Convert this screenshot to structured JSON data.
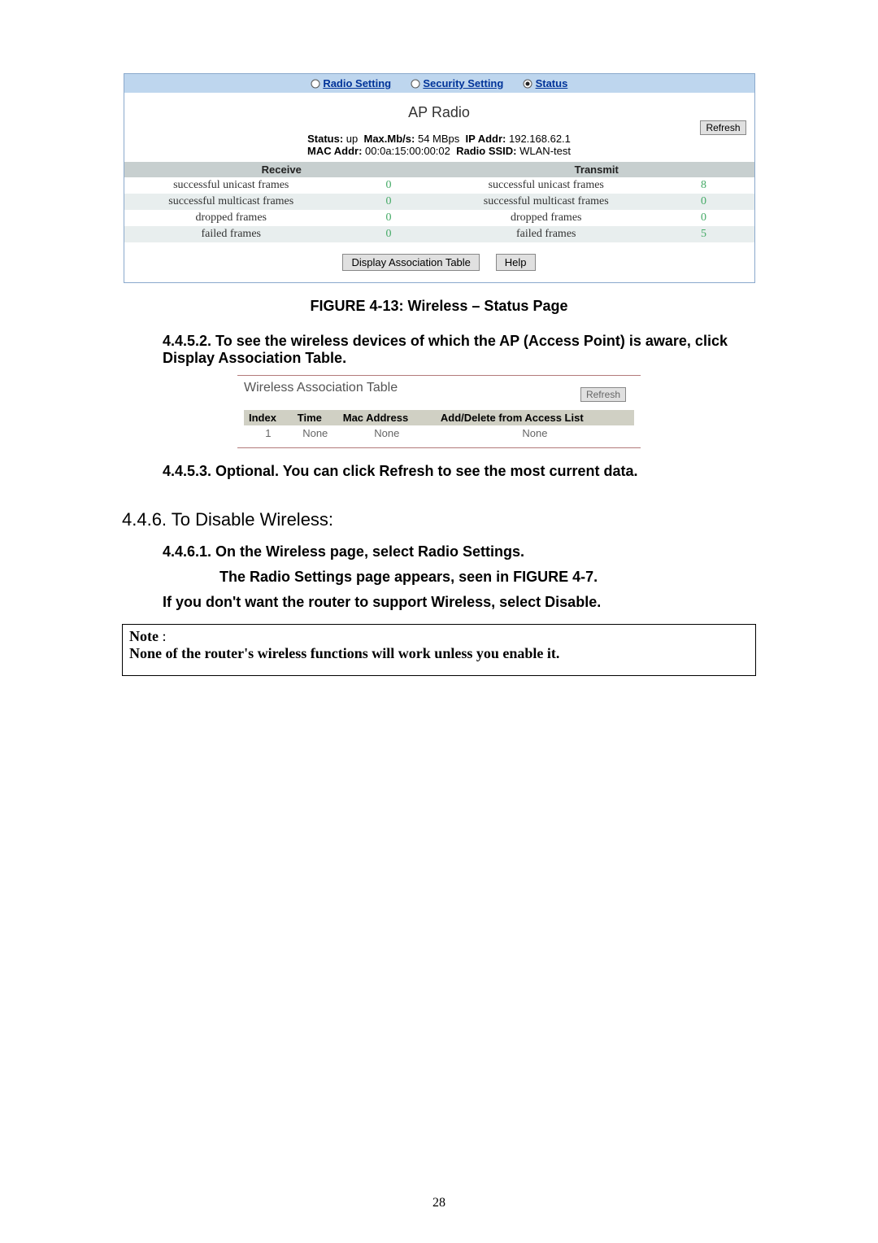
{
  "tabs": {
    "radio": "Radio Setting",
    "security": "Security Setting",
    "status": "Status"
  },
  "ap": {
    "title": "AP Radio",
    "refresh": "Refresh",
    "status_label": "Status:",
    "status_val": "up",
    "maxmb_label": "Max.Mb/s:",
    "maxmb_val": "54 MBps",
    "ipaddr_label": "IP Addr:",
    "ipaddr_val": "192.168.62.1",
    "macaddr_label": "MAC Addr:",
    "macaddr_val": "00:0a:15:00:00:02",
    "ssid_label": "Radio SSID:",
    "ssid_val": "WLAN-test",
    "col_receive": "Receive",
    "col_transmit": "Transmit",
    "rows": [
      {
        "rlabel": "successful unicast frames",
        "rval": "0",
        "tlabel": "successful unicast frames",
        "tval": "8"
      },
      {
        "rlabel": "successful multicast frames",
        "rval": "0",
        "tlabel": "successful multicast frames",
        "tval": "0"
      },
      {
        "rlabel": "dropped frames",
        "rval": "0",
        "tlabel": "dropped frames",
        "tval": "0"
      },
      {
        "rlabel": "failed frames",
        "rval": "0",
        "tlabel": "failed frames",
        "tval": "5"
      }
    ],
    "btn_display": "Display Association Table",
    "btn_help": "Help"
  },
  "figcap": "FIGURE 4-13: Wireless – Status Page",
  "p_4_4_5_2": "4.4.5.2. To see the wireless devices of which the AP (Access Point) is aware, click Display Association Table.",
  "assoc": {
    "title": "Wireless Association Table",
    "refresh": "Refresh",
    "h_index": "Index",
    "h_time": "Time",
    "h_mac": "Mac Address",
    "h_access": "Add/Delete from Access List",
    "r_index": "1",
    "r_time": "None",
    "r_mac": "None",
    "r_access": "None"
  },
  "p_4_4_5_3": "4.4.5.3. Optional. You can click Refresh to see the most current data.",
  "h_4_4_6": "4.4.6. To Disable Wireless:",
  "p_4_4_6_1": "4.4.6.1. On the Wireless page, select Radio Settings.",
  "p_4_4_6_1b": "The Radio Settings page appears, seen in FIGURE 4-7.",
  "p_4_4_6_1c": "If you don't want the router to support Wireless, select Disable.",
  "note_label": "Note",
  "note_colon": " :",
  "note_body": "None of the router's wireless functions will work unless you enable it.",
  "pagenum": "28"
}
